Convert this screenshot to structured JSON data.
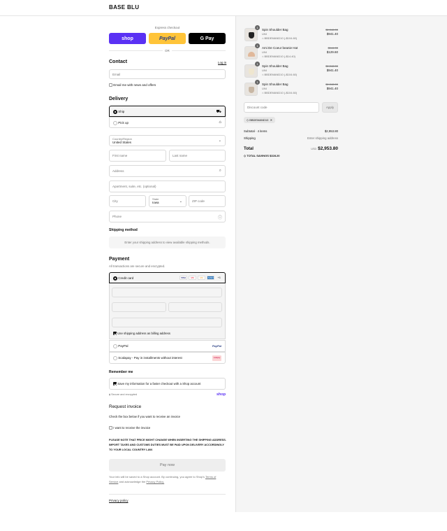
{
  "brand": "BASE BLU",
  "express": {
    "title": "Express checkout",
    "shop": "shop",
    "paypal": "PayPal",
    "gpay": "G Pay",
    "or": "OR"
  },
  "contact": {
    "title": "Contact",
    "login": "Log in",
    "email_placeholder": "Email",
    "news_label": "Email me with news and offers"
  },
  "delivery": {
    "title": "Delivery",
    "ship": "Ship",
    "pickup": "Pick up",
    "country_label": "Country/Region",
    "country_value": "United States",
    "first_name": "First name",
    "last_name": "Last name",
    "address": "Address",
    "apartment": "Apartment, suite, etc. (optional)",
    "city": "City",
    "state_label": "State",
    "state_value": "Iowa",
    "zip": "ZIP code",
    "phone": "Phone"
  },
  "shipping_method": {
    "title": "Shipping method",
    "note": "Enter your shipping address to view available shipping methods."
  },
  "payment": {
    "title": "Payment",
    "subtitle": "All transactions are secure and encrypted.",
    "credit_card": "Credit card",
    "cards": [
      "VISA",
      "MC",
      "MC",
      "AMEX"
    ],
    "more": "+1",
    "billing_label": "Use shipping address as billing address",
    "paypal": "PayPal",
    "paypal_logo": "PayPal",
    "scalapay": "Scalapay - Pay in installments without interest",
    "scalapay_logo": "scalapay"
  },
  "remember": {
    "title": "Remember me",
    "label": "Save my information for a faster checkout with a Shop account",
    "secure": "Secure and encrypted",
    "shop": "shop"
  },
  "invoice": {
    "title": "Request invoice",
    "subtitle": "Check the box below if you want to receive an invoice",
    "label": "I want to receive the invoice"
  },
  "notice": "PLEASE NOTE THAT PRICE MIGHT CHANGE WHEN INSERTING THE SHIPPING ADDRESS. IMPORT TAXES AND CUSTOMS DUTIES MUST BE PAID UPON DELIVERY ACCORDINGLY TO YOUR LOCAL COUNTRY LAW.",
  "pay_now": "Pay now",
  "legal": {
    "text_a": "Your info will be saved to a Shop account. By continuing, you agree to Shop's",
    "terms": "Terms of Service",
    "text_b": "and acknowledge the",
    "privacy": "Privacy Policy."
  },
  "footer": {
    "privacy_policy": "Privacy policy"
  },
  "items": [
    {
      "name": "Spin Shoulder Bag",
      "variant": "UNI",
      "discount": "BBDEMAND10 (-$104.60)",
      "old": "$1,046.00",
      "price": "$941.40",
      "qty": "1"
    },
    {
      "name": "Ami De Coeur beanie Hat",
      "variant": "UNI",
      "discount": "BBDEMAND10 (-$14.40)",
      "old": "$144.00",
      "price": "$129.60",
      "qty": "1"
    },
    {
      "name": "Spin Shoulder Bag",
      "variant": "UNI",
      "discount": "BBDEMAND10 (-$104.60)",
      "old": "$1,046.00",
      "price": "$941.40",
      "qty": "1"
    },
    {
      "name": "Spin Shoulder Bag",
      "variant": "UNI",
      "discount": "BBDEMAND10 (-$104.60)",
      "old": "$1,046.00",
      "price": "$941.40",
      "qty": "1"
    }
  ],
  "summary": {
    "discount_placeholder": "Discount code",
    "apply": "Apply",
    "code": "BBDEMAND10",
    "subtotal_label": "Subtotal · 4 items",
    "subtotal": "$2,953.80",
    "shipping_label": "Shipping",
    "shipping": "Enter shipping address",
    "total_label": "Total",
    "currency": "USD",
    "total": "$2,953.80",
    "savings_label": "TOTAL SAVINGS",
    "savings": "$328.20"
  }
}
